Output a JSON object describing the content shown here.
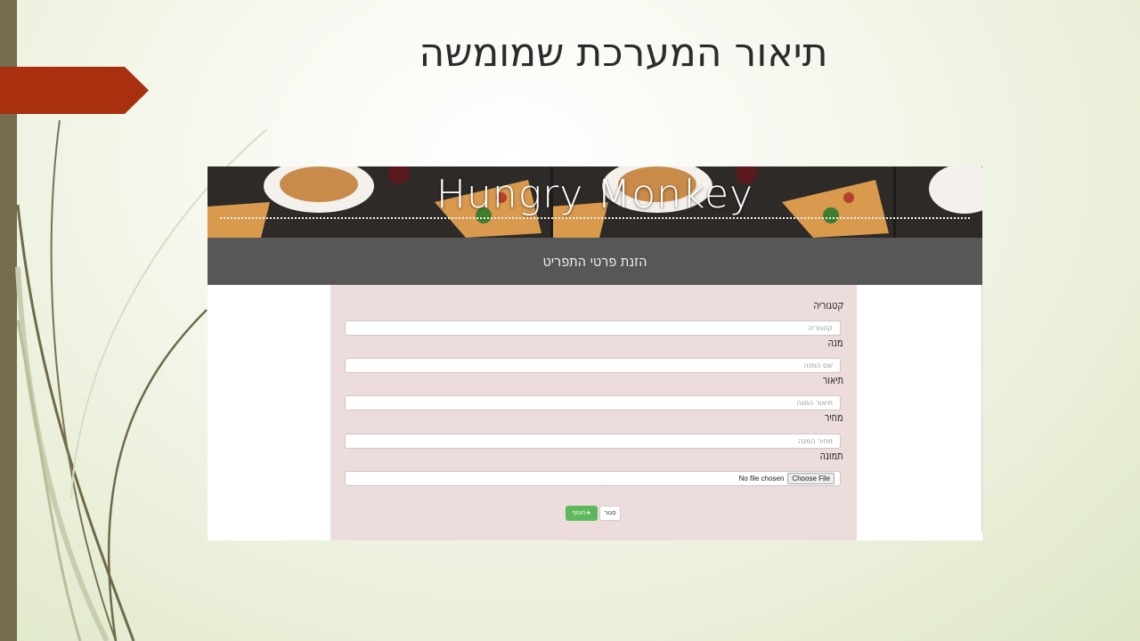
{
  "slide": {
    "title": "תיאור המערכת שמומשה"
  },
  "screenshot": {
    "brand": "Hungry Monkey",
    "page_heading": "הזנת פרטי התפריט",
    "form": {
      "fields": [
        {
          "label": "קטגוריה",
          "placeholder": "קטגוריה"
        },
        {
          "label": "מנה",
          "placeholder": "שם המנה"
        },
        {
          "label": "תיאור",
          "placeholder": "תיאור המנה"
        },
        {
          "label": "מחיר",
          "placeholder": "מחיר המנה"
        }
      ],
      "image_label": "תמונה",
      "file_button": "Choose File",
      "file_status": "No file chosen",
      "add_button": "הוסף",
      "add_icon": "plus-icon",
      "close_button": "סגור"
    },
    "colors": {
      "accent_red": "#a8300f",
      "add_green": "#5cb85c",
      "heading_bar": "#575757",
      "form_bg": "#eddcdc"
    }
  }
}
